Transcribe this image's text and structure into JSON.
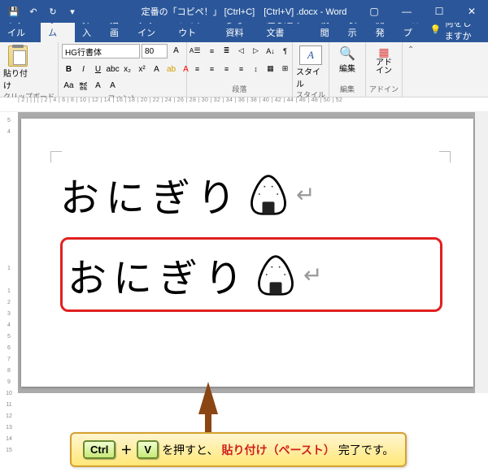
{
  "titlebar": {
    "title": "定番の「コピペ！」 [Ctrl+C]　[Ctrl+V] .docx - Word"
  },
  "tabs": {
    "file": "ファイル",
    "home": "ホーム",
    "insert": "挿入",
    "draw": "描画",
    "design": "デザイン",
    "layout": "レイアウト",
    "references": "参考資料",
    "mailings": "差し込み文書",
    "review": "校閲",
    "view": "表示",
    "developer": "開発",
    "help": "ヘルプ",
    "tellme": "何をしますか"
  },
  "ribbon": {
    "clipboard": {
      "label": "クリップボード",
      "paste": "貼り付け"
    },
    "font": {
      "label": "フォント",
      "name": "HG行書体",
      "size": "80"
    },
    "paragraph": {
      "label": "段落"
    },
    "styles": {
      "label": "スタイル",
      "btn": "スタイル"
    },
    "editing": {
      "label": "編集",
      "btn": "編集"
    },
    "addins": {
      "label": "アドイン",
      "btn": "アド\nイン"
    }
  },
  "ruler_h": "| 2 | | | | | 2 | 4 | 6 | 8 | 10 | 12 | 14 | 16 | 18 | 20 | 22 | 24 | 26 | 28 | 30 | 32 | 34 | 36 | 38 | 40 | 42 | 44 | 46 | 48 | 50 | 52",
  "ruler_v": "5\n4\n\n\n\n\n\n\n\n\n\n\n\n1\n\n1\n2\n3\n4\n5\n6\n7\n8\n9\n10\n11\n12\n13\n14\n15",
  "document": {
    "line1": "おにぎり",
    "line2": "おにぎり"
  },
  "callout": {
    "key1": "Ctrl",
    "plus": "＋",
    "key2": "V",
    "text1": " を押すと、",
    "text2": "貼り付け（ペースト）",
    "text3": "完了です。"
  }
}
